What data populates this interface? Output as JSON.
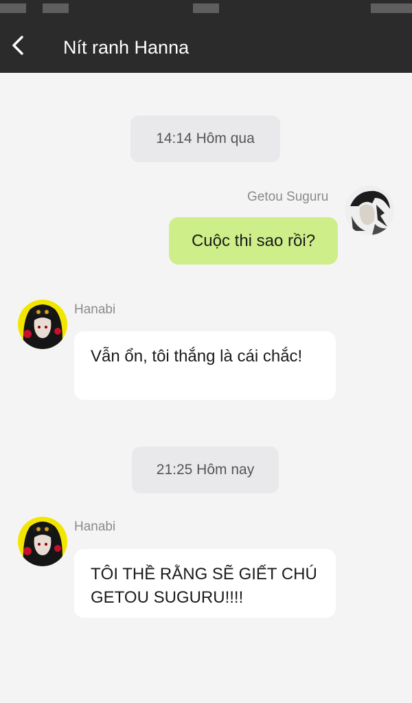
{
  "header": {
    "title": "Nít ranh Hanna",
    "back_icon": "chevron-left-icon"
  },
  "colors": {
    "header_bg": "#2b2b2b",
    "chat_bg": "#f4f4f4",
    "outgoing_bubble": "#cdee89",
    "incoming_bubble": "#ffffff",
    "timestamp_bg": "#e9e9eb"
  },
  "messages": [
    {
      "type": "timestamp",
      "text": "14:14 Hôm qua"
    },
    {
      "type": "outgoing",
      "sender": "Getou Suguru",
      "text": "Cuộc thi sao rồi?"
    },
    {
      "type": "incoming",
      "sender": "Hanabi",
      "text": "Vẫn ổn, tôi thắng là cái chắc!"
    },
    {
      "type": "timestamp",
      "text": "21:25 Hôm nay"
    },
    {
      "type": "incoming",
      "sender": "Hanabi",
      "text": "TÔI THỀ RẰNG SẼ GIẾT CHÚ GETOU SUGURU!!!!"
    }
  ]
}
